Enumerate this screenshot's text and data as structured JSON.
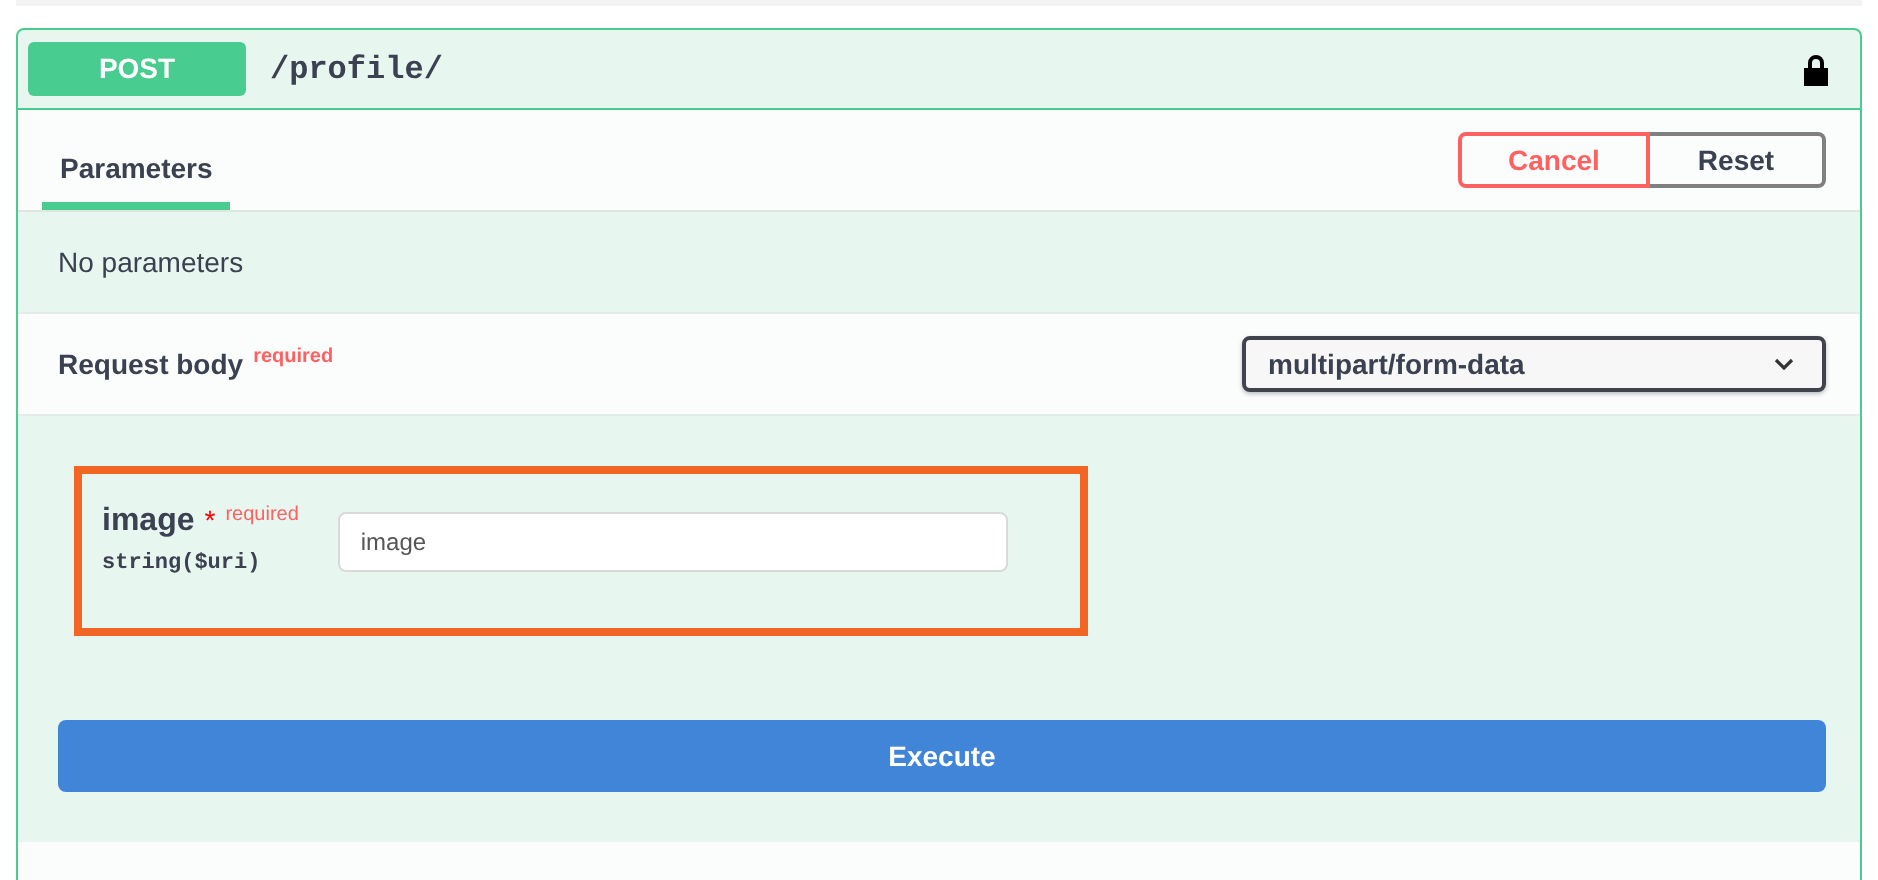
{
  "endpoint": {
    "method": "POST",
    "path": "/profile/"
  },
  "tabs": [
    {
      "label": "Parameters",
      "selected": true
    }
  ],
  "actions": [
    {
      "label": "Cancel",
      "kind": "cancel"
    },
    {
      "label": "Reset",
      "kind": "reset"
    }
  ],
  "parameters_message": "No parameters",
  "request_body": {
    "title": "Request body",
    "required_label": "required",
    "content_type": "multipart/form-data"
  },
  "fields": [
    {
      "name": "image",
      "required_mark": "*",
      "required_label": "required",
      "type": "string($uri)",
      "placeholder": "image",
      "highlighted": true
    }
  ],
  "execute_button": "Execute"
}
